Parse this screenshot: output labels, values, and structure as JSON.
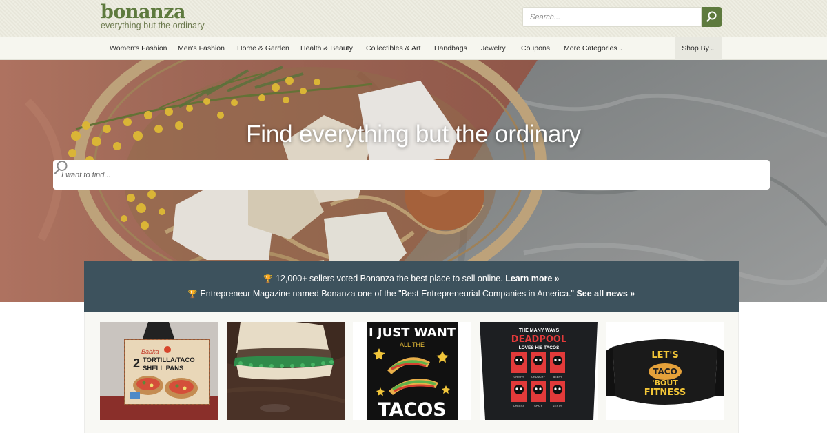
{
  "header": {
    "logo_word": "bonanza",
    "logo_tagline": "everything but the ordinary",
    "search_placeholder": "Search..."
  },
  "nav": {
    "items": [
      {
        "label": "Women's Fashion"
      },
      {
        "label": "Men's Fashion"
      },
      {
        "label": "Home & Garden"
      },
      {
        "label": "Health & Beauty"
      },
      {
        "label": "Collectibles & Art"
      },
      {
        "label": "Handbags"
      },
      {
        "label": "Jewelry"
      },
      {
        "label": "Coupons"
      },
      {
        "label": "More Categories"
      }
    ],
    "shop_by": "Shop By"
  },
  "hero": {
    "title": "Find everything but the ordinary",
    "search_placeholder": "I want to find..."
  },
  "announcements": [
    {
      "text": "12,000+ sellers voted Bonanza the best place to sell online.",
      "link": "Learn more »"
    },
    {
      "text": "Entrepreneur Magazine named Bonanza one of the \"Best Entrepreneurial Companies in America.\"",
      "link": "See all news »"
    }
  ],
  "products": [
    {
      "image_text": [
        "Babka",
        "2",
        "TORTILLA/TACO",
        "SHELL PANS"
      ]
    },
    {
      "image_text": []
    },
    {
      "image_text": [
        "I JUST WANT",
        "ALL THE",
        "TACOS"
      ]
    },
    {
      "image_text": [
        "THE MANY WAYS",
        "DEADPOOL",
        "LOVES HIS TACOS",
        "CRISPY",
        "CRUNCHY",
        "BEEFY",
        "CHEESY",
        "SPICY",
        "ZESTY"
      ]
    },
    {
      "image_text": [
        "LET'S",
        "TACO",
        "'BOUT",
        "FITNESS"
      ]
    }
  ],
  "colors": {
    "brand_green": "#5e7a3e",
    "announce_bg": "#3d525d",
    "header_bg": "#ebeadd"
  }
}
